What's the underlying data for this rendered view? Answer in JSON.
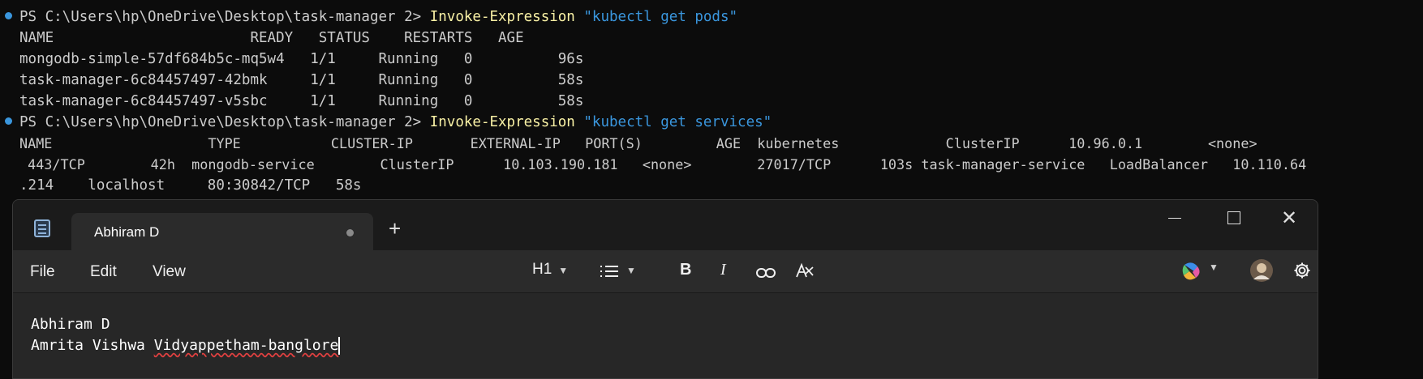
{
  "terminal": {
    "lines": [
      {
        "prompt": "PS C:\\Users\\hp\\OneDrive\\Desktop\\task-manager 2> ",
        "cmd": "Invoke-Expression",
        "arg": " \"kubectl get pods\""
      },
      {
        "text": "NAME                       READY   STATUS    RESTARTS   AGE"
      },
      {
        "text": "mongodb-simple-57df684b5c-mq5w4   1/1     Running   0          96s"
      },
      {
        "text": "task-manager-6c84457497-42bmk     1/1     Running   0          58s"
      },
      {
        "text": "task-manager-6c84457497-v5sbc     1/1     Running   0          58s"
      },
      {
        "prompt": "PS C:\\Users\\hp\\OneDrive\\Desktop\\task-manager 2> ",
        "cmd": "Invoke-Expression",
        "arg": " \"kubectl get services\""
      },
      {
        "text": "NAME                   TYPE           CLUSTER-IP       EXTERNAL-IP   PORT(S)         AGE  kubernetes             ClusterIP      10.96.0.1        <none>"
      },
      {
        "text": " 443/TCP        42h  mongodb-service        ClusterIP      10.103.190.181   <none>        27017/TCP      103s task-manager-service   LoadBalancer   10.110.64"
      },
      {
        "text": ".214    localhost     80:30842/TCP   58s"
      }
    ]
  },
  "notepad": {
    "tab_title": "Abhiram D",
    "plus": "+",
    "menu": {
      "file": "File",
      "edit": "Edit",
      "view": "View"
    },
    "toolbar": {
      "heading": "H1",
      "bold": "B",
      "italic": "I"
    },
    "content": {
      "line1": "Abhiram D",
      "line2_pre": "Amrita Vishwa ",
      "line2_misspelled": "Vidyappetham-banglore"
    }
  }
}
